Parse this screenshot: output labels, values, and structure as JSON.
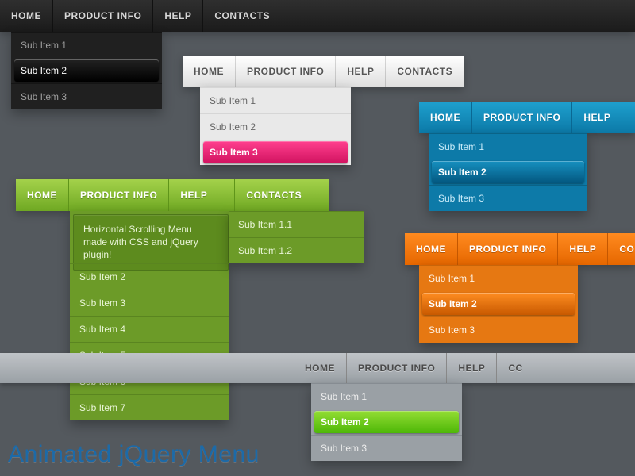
{
  "title": "Animated jQuery Menu",
  "labels": {
    "home": "HOME",
    "product_info": "PRODUCT INFO",
    "help": "HELP",
    "contacts": "CONTACTS",
    "cont_trunc": "CONT"
  },
  "dark": {
    "sub0": "Sub Item 1",
    "sub1": "Sub Item 2",
    "sub2": "Sub Item 3"
  },
  "light": {
    "sub0": "Sub Item 1",
    "sub1": "Sub Item 2",
    "sub2": "Sub Item 3"
  },
  "blue": {
    "sub0": "Sub Item 1",
    "sub1": "Sub Item 2",
    "sub2": "Sub Item 3"
  },
  "orange": {
    "sub0": "Sub Item 1",
    "sub1": "Sub Item 2",
    "sub2": "Sub Item 3"
  },
  "gray": {
    "sub0": "Sub Item 1",
    "sub1": "Sub Item 2",
    "sub2": "Sub Item 3",
    "cc": "CC"
  },
  "green": {
    "tooltip": "Horizontal Scrolling Menu made with CSS and jQuery plugin!",
    "sub1": "Sub Item 2",
    "sub2": "Sub Item 3",
    "sub3": "Sub Item 4",
    "sub4": "Sub Item 5",
    "sub5": "Sub Item 6",
    "sub6": "Sub Item 7",
    "fly0": "Sub Item 1.1",
    "fly1": "Sub Item 1.2"
  }
}
